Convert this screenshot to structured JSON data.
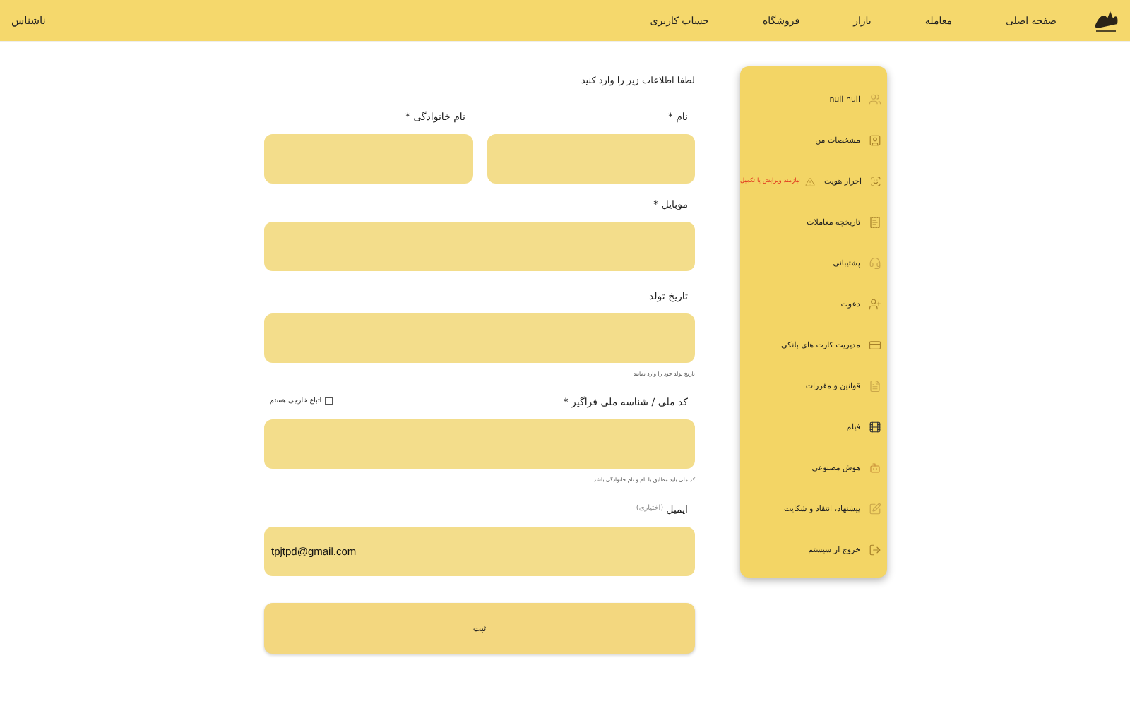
{
  "nav": {
    "items": [
      {
        "label": "صفحه اصلی"
      },
      {
        "label": "معامله"
      },
      {
        "label": "بازار"
      },
      {
        "label": "فروشگاه"
      },
      {
        "label": "حساب کاربری"
      }
    ],
    "user": "ناشناس"
  },
  "sidebar": {
    "items": [
      {
        "label": "null null",
        "kind": "user"
      },
      {
        "label": "مشخصات من",
        "kind": "profile"
      },
      {
        "label": "احراز هویت",
        "kind": "id",
        "warning": "نیازمند ویرایش یا تکمیل"
      },
      {
        "label": "تاریخچه معاملات",
        "kind": "history"
      },
      {
        "label": "پشتیبانی",
        "kind": "support"
      },
      {
        "label": "دعوت",
        "kind": "invite"
      },
      {
        "label": "مدیریت کارت های بانکی",
        "kind": "card"
      },
      {
        "label": "قوانین و مقررات",
        "kind": "rules"
      },
      {
        "label": "فیلم",
        "kind": "film"
      },
      {
        "label": "هوش مصنوعی",
        "kind": "ai"
      },
      {
        "label": "پیشنهاد، انتقاد و شکایت",
        "kind": "feedback"
      },
      {
        "label": "خروج از سیستم",
        "kind": "logout"
      }
    ]
  },
  "form": {
    "intro": "لطفا اطلاعات زیر را وارد کنید",
    "first_name": {
      "label": "نام *"
    },
    "last_name": {
      "label": "نام خانوادگی *"
    },
    "mobile": {
      "label": "موبایل *"
    },
    "birth_date": {
      "label": "تاریخ تولد",
      "hint": "تاریخ تولد خود را وارد نمایید"
    },
    "national_code": {
      "label": "کد ملی / شناسه ملی فراگیر *",
      "hint": "کد ملی باید مطابق با نام و نام خانوادگی باشد"
    },
    "foreign": {
      "label": "اتباع خارجی هستم",
      "checked": false
    },
    "email": {
      "label": "ایمیل",
      "note": "(اختیاری)",
      "value": "tpjtpd@gmail.com"
    },
    "submit": "ثبت"
  }
}
